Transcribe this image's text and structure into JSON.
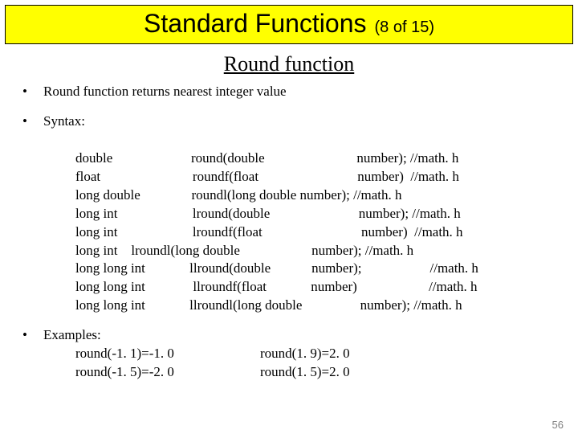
{
  "title": {
    "main": "Standard Functions",
    "sub": "(8 of 15)"
  },
  "section_header": "Round function",
  "bullets": {
    "b1": "Round function returns nearest integer value",
    "b2": "Syntax:",
    "b3": "Examples:"
  },
  "syntax_lines": {
    "l1": "double                       round(double                           number); //math. h",
    "l2": "float                           roundf(float                             number)  //math. h",
    "l3": "long double               roundl(long double number); //math. h",
    "l4": "long int                      lround(double                          number); //math. h",
    "l5": "long int                      lroundf(float                             number)  //math. h",
    "l6": "long int    lroundl(long double                     number); //math. h",
    "l7": "long long int             llround(double            number);                    //math. h",
    "l8": "long long int              llroundf(float             number)                     //math. h",
    "l9": "long long int             llroundl(long double                 number); //math. h"
  },
  "examples": {
    "r1": {
      "left": "round(-1. 1)=-1. 0",
      "right": "round(1. 9)=2. 0"
    },
    "r2": {
      "left": "round(-1. 5)=-2. 0",
      "right": "round(1. 5)=2. 0"
    }
  },
  "page_number": "56"
}
